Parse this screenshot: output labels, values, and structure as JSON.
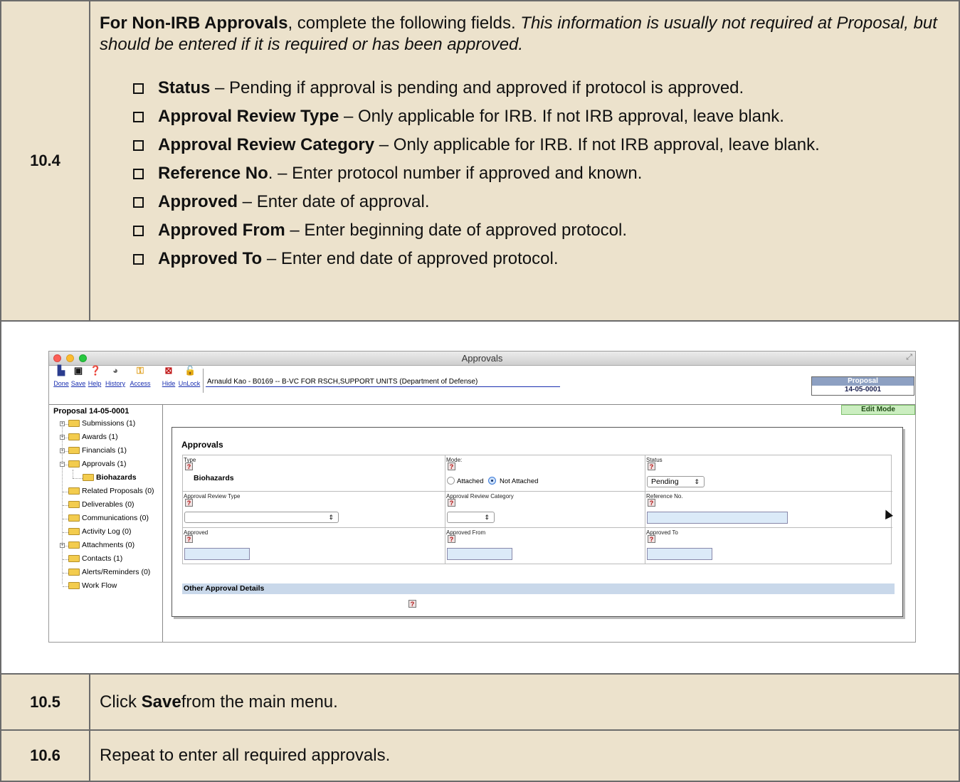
{
  "step_10_4": {
    "number": "10.4",
    "intro_bold": "For Non-IRB Approvals",
    "intro_plain": ", complete the following fields. ",
    "intro_italic": "This information is usually not required at Proposal, but should be entered if it is required or has been approved.",
    "items": [
      {
        "bold": "Status",
        "text": " – Pending if approval is pending and approved if protocol is approved."
      },
      {
        "bold": "Approval Review Type",
        "text": " – Only applicable for IRB. If not IRB approval, leave blank."
      },
      {
        "bold": "Approval Review Category",
        "text": " – Only applicable for IRB. If not IRB approval, leave blank."
      },
      {
        "bold": "Reference No",
        "text": ". – Enter protocol number if approved and known."
      },
      {
        "bold": "Approved",
        "text": " – Enter date of approval."
      },
      {
        "bold": "Approved From",
        "text": " – Enter beginning date of approved protocol."
      },
      {
        "bold": "Approved To",
        "text": " – Enter end date of approved protocol."
      }
    ]
  },
  "screenshot": {
    "window_title": "Approvals",
    "toolbar": {
      "done": "Done",
      "save": "Save",
      "help": "Help",
      "history": "History",
      "access": "Access",
      "hide": "Hide",
      "unlock": "UnLock"
    },
    "user_line": "Arnauld Kao - B0169 -- B-VC FOR RSCH,SUPPORT UNITS (Department of Defense)",
    "proposal_label": "Proposal",
    "proposal_number": "14-05-0001",
    "edit_mode": "Edit Mode",
    "tree": {
      "title": "Proposal 14-05-0001",
      "items": [
        "Submissions (1)",
        "Awards (1)",
        "Financials (1)",
        "Approvals (1)",
        "Biohazards",
        "Related Proposals (0)",
        "Deliverables (0)",
        "Communications (0)",
        "Activity Log (0)",
        "Attachments (0)",
        "Contacts (1)",
        "Alerts/Reminders (0)",
        "Work Flow"
      ]
    },
    "panel": {
      "title": "Approvals",
      "type_label": "Type",
      "type_value": "Biohazards",
      "mode_label": "Mode:",
      "mode_attached": "Attached",
      "mode_not_attached": "Not Attached",
      "status_label": "Status",
      "status_value": "Pending",
      "review_type_label": "Approval Review Type",
      "review_category_label": "Approval Review Category",
      "reference_label": "Reference No.",
      "approved_label": "Approved",
      "approved_from_label": "Approved From",
      "approved_to_label": "Approved To",
      "other_details": "Other Approval Details",
      "help_glyph": "?"
    }
  },
  "step_10_5": {
    "number": "10.5",
    "pre": "Click ",
    "bold": "Save",
    "post": " from the main menu."
  },
  "step_10_6": {
    "number": "10.6",
    "text": "Repeat to enter all required approvals."
  }
}
